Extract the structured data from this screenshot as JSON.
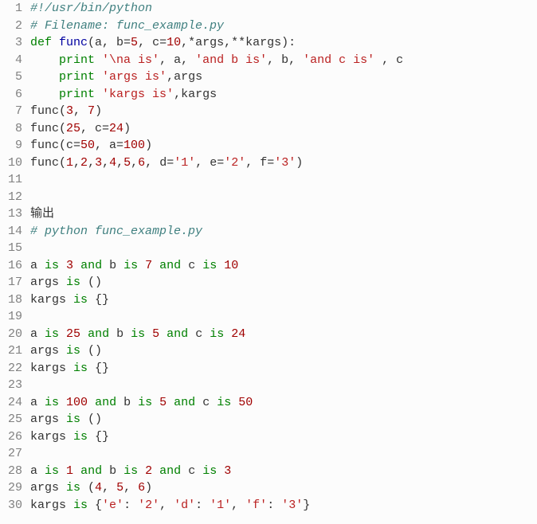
{
  "filename": "func_example.py",
  "output_label": "输出",
  "run_command": "# python func_example.py",
  "code_lines": [
    {
      "n": 1,
      "tokens": [
        [
          "c-comment",
          "#!/usr/bin/python"
        ]
      ]
    },
    {
      "n": 2,
      "tokens": [
        [
          "c-comment",
          "# Filename: func_example.py"
        ]
      ]
    },
    {
      "n": 3,
      "tokens": [
        [
          "c-keyword",
          "def "
        ],
        [
          "c-funcname",
          "func"
        ],
        [
          "c-plain",
          "(a, b="
        ],
        [
          "c-number",
          "5"
        ],
        [
          "c-plain",
          ", c="
        ],
        [
          "c-number",
          "10"
        ],
        [
          "c-plain",
          ",*args,**kargs):"
        ]
      ]
    },
    {
      "n": 4,
      "tokens": [
        [
          "c-plain",
          "    "
        ],
        [
          "c-keyword",
          "print"
        ],
        [
          "c-plain",
          " "
        ],
        [
          "c-string",
          "'\\na is'"
        ],
        [
          "c-plain",
          ", a, "
        ],
        [
          "c-string",
          "'and b is'"
        ],
        [
          "c-plain",
          ", b, "
        ],
        [
          "c-string",
          "'and c is'"
        ],
        [
          "c-plain",
          " , c"
        ]
      ]
    },
    {
      "n": 5,
      "tokens": [
        [
          "c-plain",
          "    "
        ],
        [
          "c-keyword",
          "print"
        ],
        [
          "c-plain",
          " "
        ],
        [
          "c-string",
          "'args is'"
        ],
        [
          "c-plain",
          ",args"
        ]
      ]
    },
    {
      "n": 6,
      "tokens": [
        [
          "c-plain",
          "    "
        ],
        [
          "c-keyword",
          "print"
        ],
        [
          "c-plain",
          " "
        ],
        [
          "c-string",
          "'kargs is'"
        ],
        [
          "c-plain",
          ",kargs"
        ]
      ]
    },
    {
      "n": 7,
      "tokens": [
        [
          "c-plain",
          "func("
        ],
        [
          "c-number",
          "3"
        ],
        [
          "c-plain",
          ", "
        ],
        [
          "c-number",
          "7"
        ],
        [
          "c-plain",
          ")"
        ]
      ]
    },
    {
      "n": 8,
      "tokens": [
        [
          "c-plain",
          "func("
        ],
        [
          "c-number",
          "25"
        ],
        [
          "c-plain",
          ", c="
        ],
        [
          "c-number",
          "24"
        ],
        [
          "c-plain",
          ")"
        ]
      ]
    },
    {
      "n": 9,
      "tokens": [
        [
          "c-plain",
          "func(c="
        ],
        [
          "c-number",
          "50"
        ],
        [
          "c-plain",
          ", a="
        ],
        [
          "c-number",
          "100"
        ],
        [
          "c-plain",
          ")"
        ]
      ]
    },
    {
      "n": 10,
      "tokens": [
        [
          "c-plain",
          "func("
        ],
        [
          "c-number",
          "1"
        ],
        [
          "c-plain",
          ","
        ],
        [
          "c-number",
          "2"
        ],
        [
          "c-plain",
          ","
        ],
        [
          "c-number",
          "3"
        ],
        [
          "c-plain",
          ","
        ],
        [
          "c-number",
          "4"
        ],
        [
          "c-plain",
          ","
        ],
        [
          "c-number",
          "5"
        ],
        [
          "c-plain",
          ","
        ],
        [
          "c-number",
          "6"
        ],
        [
          "c-plain",
          ", d="
        ],
        [
          "c-string",
          "'1'"
        ],
        [
          "c-plain",
          ", e="
        ],
        [
          "c-string",
          "'2'"
        ],
        [
          "c-plain",
          ", f="
        ],
        [
          "c-string",
          "'3'"
        ],
        [
          "c-plain",
          ")"
        ]
      ]
    },
    {
      "n": 11,
      "tokens": [
        [
          "c-plain",
          ""
        ]
      ]
    },
    {
      "n": 12,
      "tokens": [
        [
          "c-plain",
          ""
        ]
      ]
    },
    {
      "n": 13,
      "tokens": [
        [
          "c-plain",
          "输出"
        ]
      ]
    },
    {
      "n": 14,
      "tokens": [
        [
          "c-comment",
          "# python func_example.py"
        ]
      ]
    },
    {
      "n": 15,
      "tokens": [
        [
          "c-plain",
          ""
        ]
      ]
    },
    {
      "n": 16,
      "tokens": [
        [
          "c-plain",
          "a "
        ],
        [
          "c-keyword",
          "is"
        ],
        [
          "c-plain",
          " "
        ],
        [
          "c-number",
          "3"
        ],
        [
          "c-plain",
          " "
        ],
        [
          "c-keyword",
          "and"
        ],
        [
          "c-plain",
          " b "
        ],
        [
          "c-keyword",
          "is"
        ],
        [
          "c-plain",
          " "
        ],
        [
          "c-number",
          "7"
        ],
        [
          "c-plain",
          " "
        ],
        [
          "c-keyword",
          "and"
        ],
        [
          "c-plain",
          " c "
        ],
        [
          "c-keyword",
          "is"
        ],
        [
          "c-plain",
          " "
        ],
        [
          "c-number",
          "10"
        ]
      ]
    },
    {
      "n": 17,
      "tokens": [
        [
          "c-plain",
          "args "
        ],
        [
          "c-keyword",
          "is"
        ],
        [
          "c-plain",
          " ()"
        ]
      ]
    },
    {
      "n": 18,
      "tokens": [
        [
          "c-plain",
          "kargs "
        ],
        [
          "c-keyword",
          "is"
        ],
        [
          "c-plain",
          " {}"
        ]
      ]
    },
    {
      "n": 19,
      "tokens": [
        [
          "c-plain",
          ""
        ]
      ]
    },
    {
      "n": 20,
      "tokens": [
        [
          "c-plain",
          "a "
        ],
        [
          "c-keyword",
          "is"
        ],
        [
          "c-plain",
          " "
        ],
        [
          "c-number",
          "25"
        ],
        [
          "c-plain",
          " "
        ],
        [
          "c-keyword",
          "and"
        ],
        [
          "c-plain",
          " b "
        ],
        [
          "c-keyword",
          "is"
        ],
        [
          "c-plain",
          " "
        ],
        [
          "c-number",
          "5"
        ],
        [
          "c-plain",
          " "
        ],
        [
          "c-keyword",
          "and"
        ],
        [
          "c-plain",
          " c "
        ],
        [
          "c-keyword",
          "is"
        ],
        [
          "c-plain",
          " "
        ],
        [
          "c-number",
          "24"
        ]
      ]
    },
    {
      "n": 21,
      "tokens": [
        [
          "c-plain",
          "args "
        ],
        [
          "c-keyword",
          "is"
        ],
        [
          "c-plain",
          " ()"
        ]
      ]
    },
    {
      "n": 22,
      "tokens": [
        [
          "c-plain",
          "kargs "
        ],
        [
          "c-keyword",
          "is"
        ],
        [
          "c-plain",
          " {}"
        ]
      ]
    },
    {
      "n": 23,
      "tokens": [
        [
          "c-plain",
          ""
        ]
      ]
    },
    {
      "n": 24,
      "tokens": [
        [
          "c-plain",
          "a "
        ],
        [
          "c-keyword",
          "is"
        ],
        [
          "c-plain",
          " "
        ],
        [
          "c-number",
          "100"
        ],
        [
          "c-plain",
          " "
        ],
        [
          "c-keyword",
          "and"
        ],
        [
          "c-plain",
          " b "
        ],
        [
          "c-keyword",
          "is"
        ],
        [
          "c-plain",
          " "
        ],
        [
          "c-number",
          "5"
        ],
        [
          "c-plain",
          " "
        ],
        [
          "c-keyword",
          "and"
        ],
        [
          "c-plain",
          " c "
        ],
        [
          "c-keyword",
          "is"
        ],
        [
          "c-plain",
          " "
        ],
        [
          "c-number",
          "50"
        ]
      ]
    },
    {
      "n": 25,
      "tokens": [
        [
          "c-plain",
          "args "
        ],
        [
          "c-keyword",
          "is"
        ],
        [
          "c-plain",
          " ()"
        ]
      ]
    },
    {
      "n": 26,
      "tokens": [
        [
          "c-plain",
          "kargs "
        ],
        [
          "c-keyword",
          "is"
        ],
        [
          "c-plain",
          " {}"
        ]
      ]
    },
    {
      "n": 27,
      "tokens": [
        [
          "c-plain",
          ""
        ]
      ]
    },
    {
      "n": 28,
      "tokens": [
        [
          "c-plain",
          "a "
        ],
        [
          "c-keyword",
          "is"
        ],
        [
          "c-plain",
          " "
        ],
        [
          "c-number",
          "1"
        ],
        [
          "c-plain",
          " "
        ],
        [
          "c-keyword",
          "and"
        ],
        [
          "c-plain",
          " b "
        ],
        [
          "c-keyword",
          "is"
        ],
        [
          "c-plain",
          " "
        ],
        [
          "c-number",
          "2"
        ],
        [
          "c-plain",
          " "
        ],
        [
          "c-keyword",
          "and"
        ],
        [
          "c-plain",
          " c "
        ],
        [
          "c-keyword",
          "is"
        ],
        [
          "c-plain",
          " "
        ],
        [
          "c-number",
          "3"
        ]
      ]
    },
    {
      "n": 29,
      "tokens": [
        [
          "c-plain",
          "args "
        ],
        [
          "c-keyword",
          "is"
        ],
        [
          "c-plain",
          " ("
        ],
        [
          "c-number",
          "4"
        ],
        [
          "c-plain",
          ", "
        ],
        [
          "c-number",
          "5"
        ],
        [
          "c-plain",
          ", "
        ],
        [
          "c-number",
          "6"
        ],
        [
          "c-plain",
          ")"
        ]
      ]
    },
    {
      "n": 30,
      "tokens": [
        [
          "c-plain",
          "kargs "
        ],
        [
          "c-keyword",
          "is"
        ],
        [
          "c-plain",
          " {"
        ],
        [
          "c-string",
          "'e'"
        ],
        [
          "c-plain",
          ": "
        ],
        [
          "c-string",
          "'2'"
        ],
        [
          "c-plain",
          ", "
        ],
        [
          "c-string",
          "'d'"
        ],
        [
          "c-plain",
          ": "
        ],
        [
          "c-string",
          "'1'"
        ],
        [
          "c-plain",
          ", "
        ],
        [
          "c-string",
          "'f'"
        ],
        [
          "c-plain",
          ": "
        ],
        [
          "c-string",
          "'3'"
        ],
        [
          "c-plain",
          "}"
        ]
      ]
    }
  ]
}
